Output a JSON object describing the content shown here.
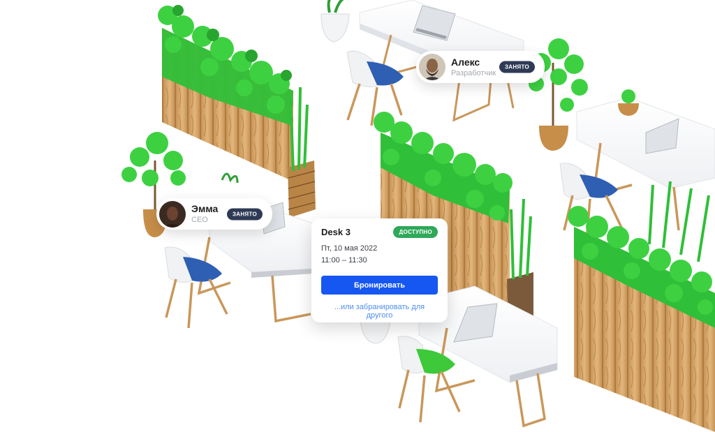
{
  "users": [
    {
      "name": "Алекс",
      "role": "Разработчик",
      "status": "ЗАНЯТО"
    },
    {
      "name": "Эмма",
      "role": "CEO",
      "status": "ЗАНЯТО"
    }
  ],
  "booking": {
    "title": "Desk 3",
    "status": "ДОСТУПНО",
    "date": "Пт, 10 мая 2022",
    "time": "11:00 – 11:30",
    "book_label": "Бронировать",
    "other_label": "...или забранировать для другого"
  },
  "colors": {
    "primary": "#1657f2",
    "available": "#2fa85a",
    "busy": "#2e3a55",
    "chair_seat_blue": "#2f5fb3",
    "chair_seat_green": "#3dc93a",
    "plant_green": "#34c23b",
    "wood": "#d7a86b"
  }
}
